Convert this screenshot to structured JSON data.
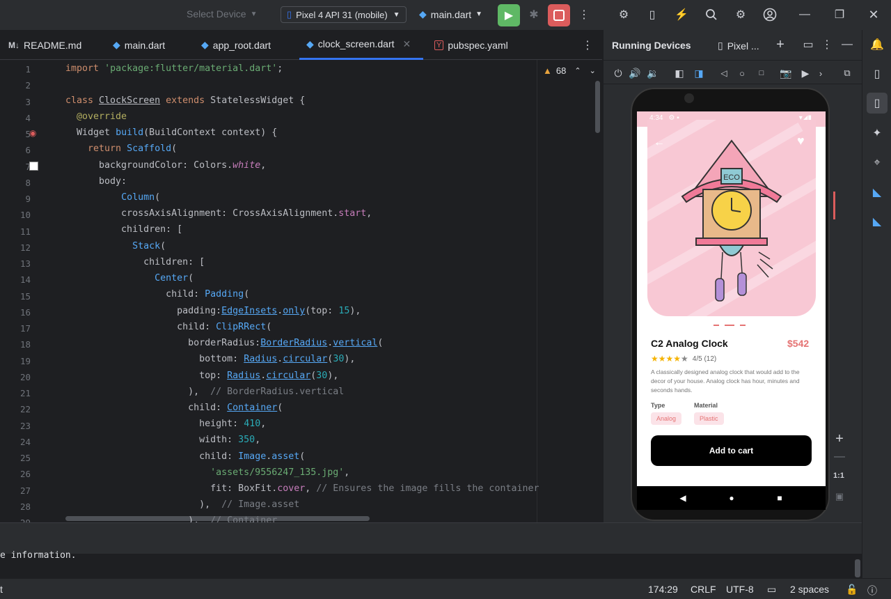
{
  "topbar": {
    "select_device": "Select Device",
    "device_selector": "Pixel 4 API 31 (mobile)",
    "run_config": "main.dart"
  },
  "tabs": [
    {
      "label": "README.md",
      "icon": "markdown-icon",
      "icon_text": "M↓"
    },
    {
      "label": "main.dart",
      "icon": "dart-icon"
    },
    {
      "label": "app_root.dart",
      "icon": "dart-icon"
    },
    {
      "label": "clock_screen.dart",
      "icon": "dart-icon",
      "active": true
    },
    {
      "label": "pubspec.yaml",
      "icon": "yaml-icon",
      "icon_text": "Y"
    }
  ],
  "editor": {
    "warnings_count": "68",
    "line_numbers": [
      "1",
      "2",
      "3",
      "4",
      "5",
      "6",
      "7",
      "8",
      "9",
      "10",
      "11",
      "12",
      "13",
      "14",
      "15",
      "16",
      "17",
      "18",
      "19",
      "20",
      "21",
      "22",
      "23",
      "24",
      "25",
      "26",
      "27",
      "28",
      "29"
    ]
  },
  "running_devices": {
    "title": "Running Devices",
    "device_tab": "Pixel ...",
    "zoom_label": "1:1"
  },
  "app": {
    "status_time": "4:34",
    "product_name": "C2 Analog Clock",
    "price": "$542",
    "rating": "4/5 (12)",
    "description": "A classically designed analog clock that would add to the decor of your house. Analog clock has hour, minutes and seconds hands.",
    "type_label": "Type",
    "type_value": "Analog",
    "material_label": "Material",
    "material_value": "Plastic",
    "cta": "Add to cart",
    "clock_sign": "ECO"
  },
  "bottom_panel": {
    "text": "e information."
  },
  "statusbar": {
    "left_text": "t",
    "position": "174:29",
    "line_ending": "CRLF",
    "encoding": "UTF-8",
    "indent": "2 spaces"
  },
  "colors": {
    "accent": "#3574f0",
    "run_green": "#5fb865",
    "stop_red": "#db5c5c",
    "price": "#e57373",
    "pink": "#f8c8d4"
  }
}
